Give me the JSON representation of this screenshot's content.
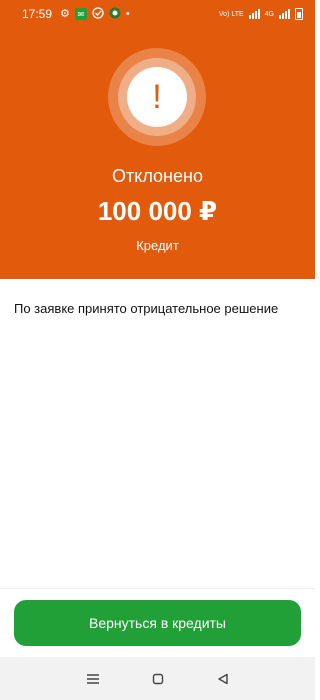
{
  "statusbar": {
    "time": "17:59",
    "network_label_1": "Vo) LTE",
    "network_label_2": "4G",
    "icons": [
      "gear-icon",
      "app-icon",
      "check-circle-icon",
      "notification-icon",
      "dot-icon",
      "signal-icon",
      "battery-icon"
    ]
  },
  "colors": {
    "accent": "#e25a0b",
    "button": "#21a038",
    "text": "#111111"
  },
  "hero": {
    "status_icon": "exclamation-icon",
    "status_symbol": "!",
    "status_title": "Отклонено",
    "amount": "100 000 ₽",
    "product": "Кредит"
  },
  "message": "По заявке принято отрицательное решение",
  "cta_label": "Вернуться в кредиты",
  "navbar": {
    "icons": [
      "menu-icon",
      "home-square-icon",
      "back-triangle-icon"
    ]
  }
}
